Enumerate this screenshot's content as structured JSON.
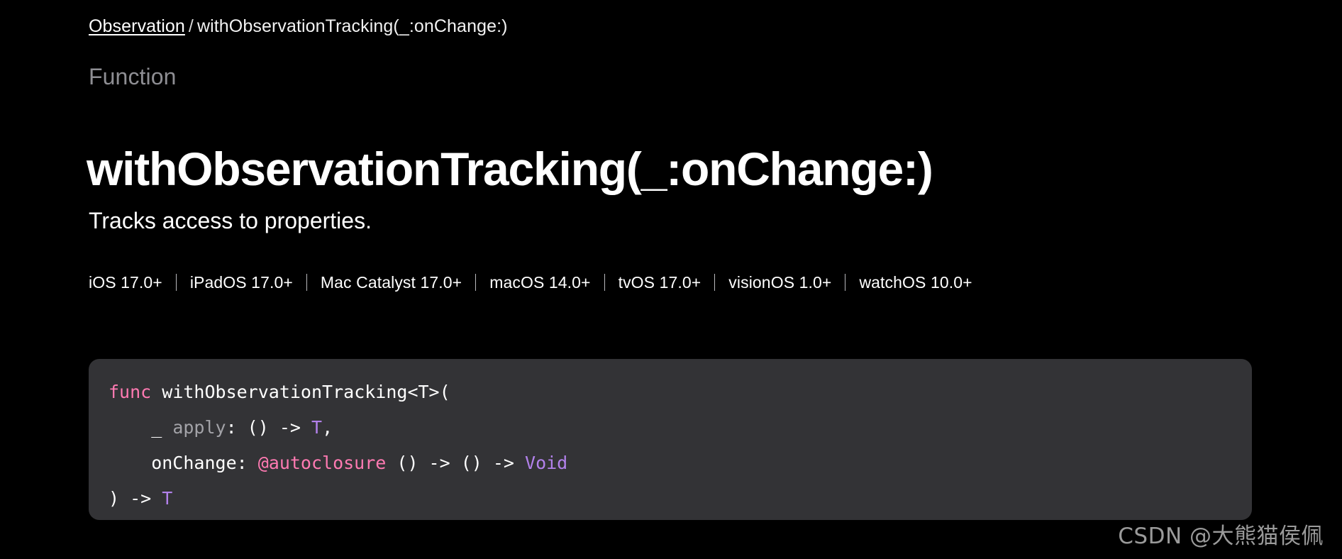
{
  "breadcrumb": {
    "link_label": "Observation",
    "separator": "/",
    "current": "withObservationTracking(_:onChange:)"
  },
  "header": {
    "eyebrow": "Function",
    "title": "withObservationTracking(_:onChange:)",
    "abstract": "Tracks access to properties."
  },
  "availability": {
    "platforms": [
      "iOS 17.0+",
      "iPadOS 17.0+",
      "Mac Catalyst 17.0+",
      "macOS 14.0+",
      "tvOS 17.0+",
      "visionOS 1.0+",
      "watchOS 10.0+"
    ]
  },
  "declaration": {
    "lines": [
      [
        {
          "text": "func",
          "kind": "kw"
        },
        {
          "text": " withObservationTracking<T>(",
          "kind": "plain"
        }
      ],
      [
        {
          "text": "    _ ",
          "kind": "plain"
        },
        {
          "text": "apply",
          "kind": "param"
        },
        {
          "text": ": () -> ",
          "kind": "plain"
        },
        {
          "text": "T",
          "kind": "type"
        },
        {
          "text": ",",
          "kind": "plain"
        }
      ],
      [
        {
          "text": "    onChange: ",
          "kind": "plain"
        },
        {
          "text": "@autoclosure",
          "kind": "attr"
        },
        {
          "text": " () -> () -> ",
          "kind": "plain"
        },
        {
          "text": "Void",
          "kind": "type"
        }
      ],
      [
        {
          "text": ") -> ",
          "kind": "plain"
        },
        {
          "text": "T",
          "kind": "type"
        }
      ]
    ]
  },
  "watermark": {
    "text": "CSDN @大熊猫侯佩"
  },
  "colors": {
    "background": "#000000",
    "code_background": "#333336",
    "keyword": "#ff7ab2",
    "type": "#b281eb",
    "param": "#a3a3a8",
    "eyebrow": "#8e8e93",
    "watermark": "#9a9a9a"
  }
}
